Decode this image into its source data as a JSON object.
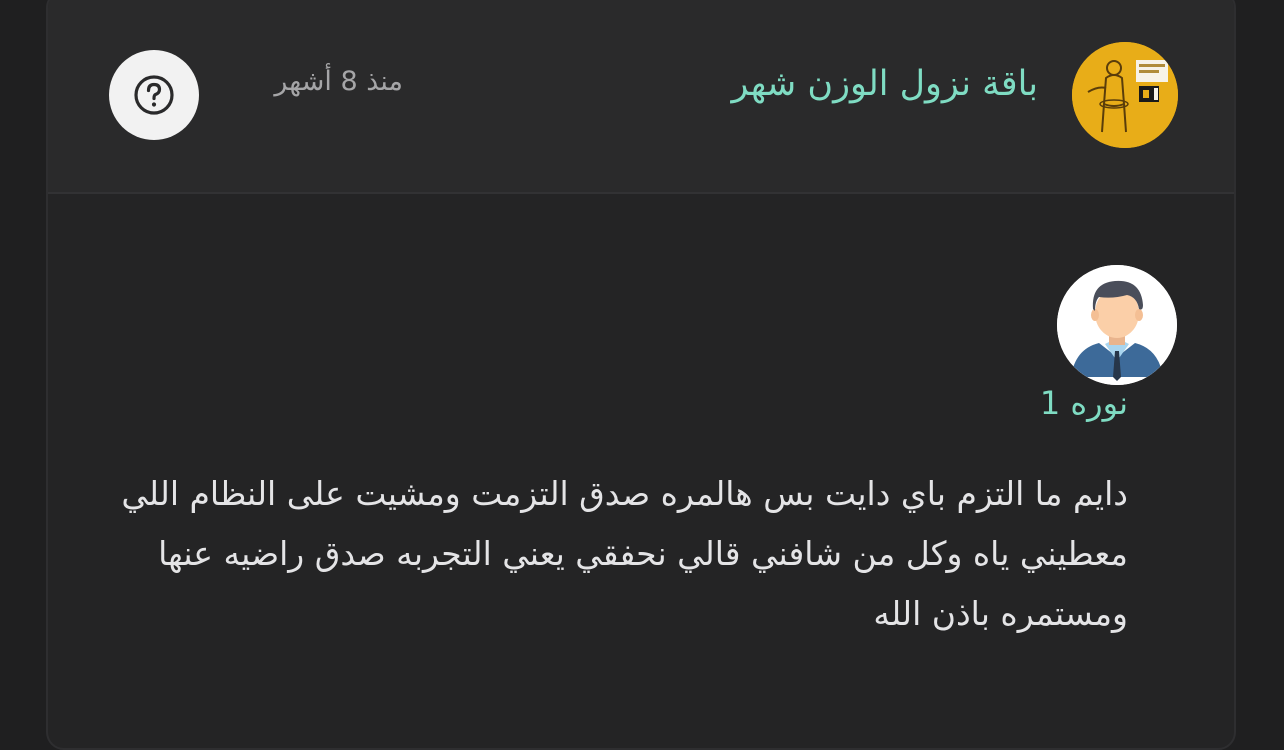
{
  "header": {
    "product_title": "باقة نزول الوزن شهر",
    "time_ago": "منذ 8 أشهر",
    "product_thumb_icon": "weight-loss-package-thumbnail-icon",
    "help_icon": "question-circle-icon"
  },
  "review": {
    "reviewer_name": "نوره 1",
    "avatar_icon": "user-avatar-icon",
    "text": "دايم ما التزم باي دايت بس هالمره صدق التزمت ومشيت على النظام اللي معطيني ياه وكل من شافني قالي نحفقي يعني التجربه صدق راضيه عنها ومستمره باذن الله"
  },
  "colors": {
    "accent": "#7fdcc3",
    "background": "#1f1f20",
    "card": "#242425",
    "header": "#2a2a2b",
    "thumb": "#e8ad18"
  }
}
